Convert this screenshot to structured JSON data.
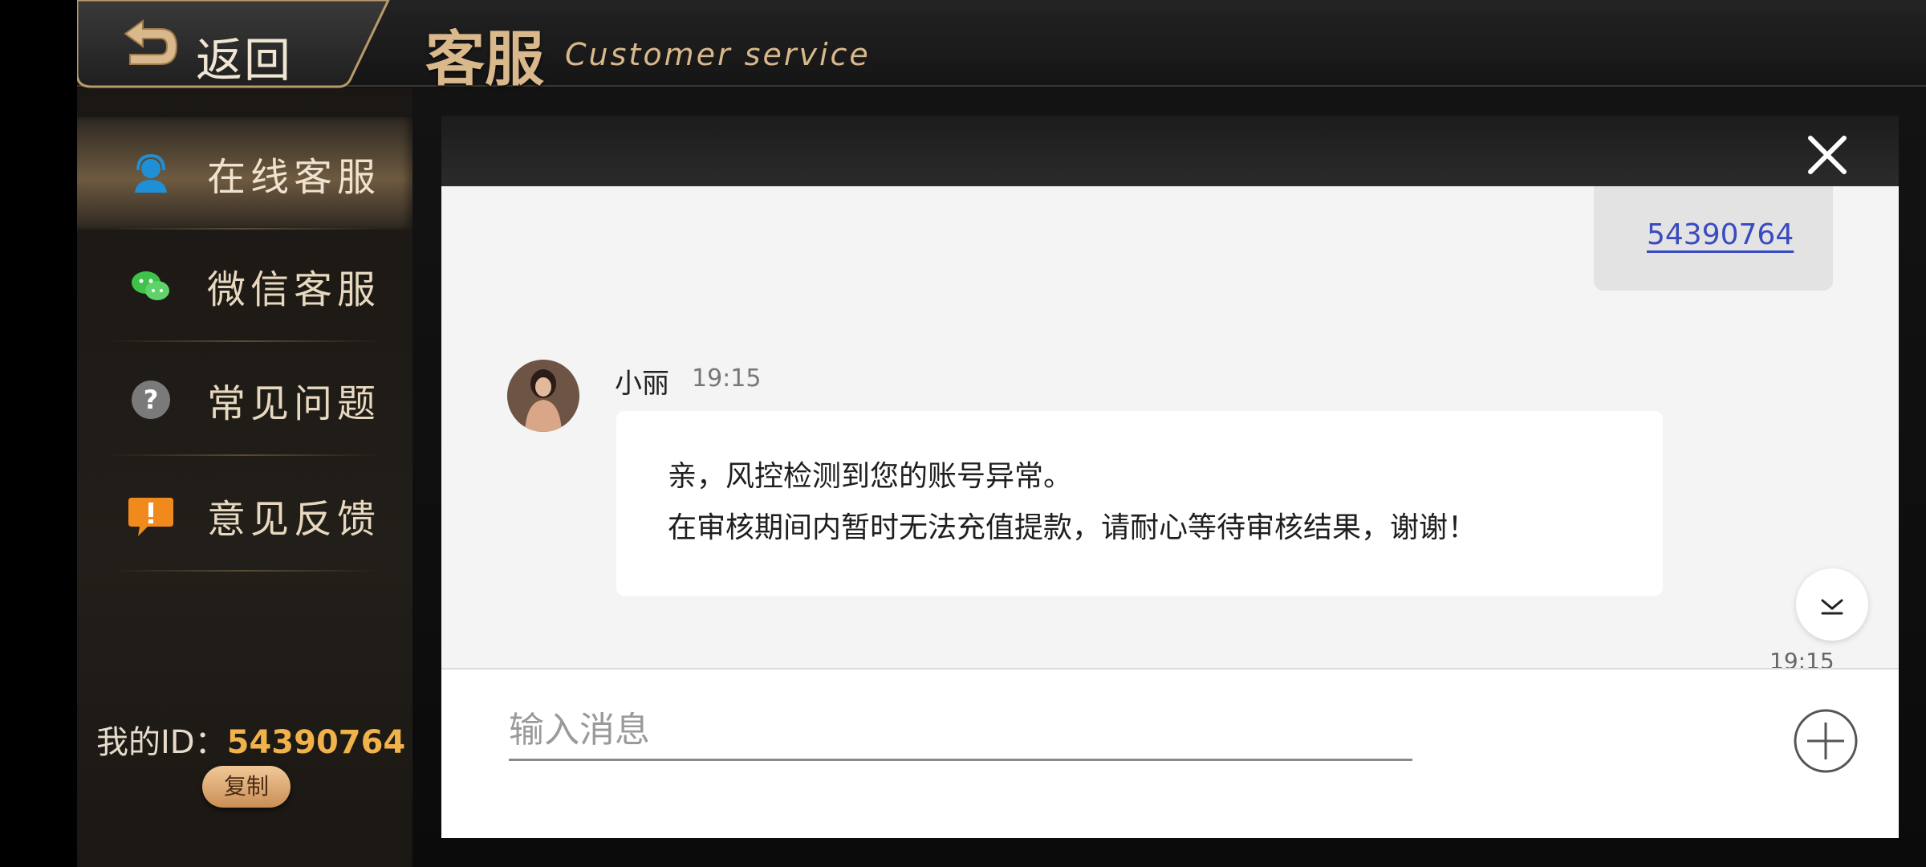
{
  "topbar": {
    "back_label": "返回",
    "title": "客服",
    "subtitle": "Customer service"
  },
  "sidebar": {
    "items": [
      {
        "label": "在线客服",
        "icon": "headset-agent-icon",
        "active": true
      },
      {
        "label": "微信客服",
        "icon": "wechat-icon",
        "active": false
      },
      {
        "label": "常见问题",
        "icon": "question-icon",
        "active": false
      },
      {
        "label": "意见反馈",
        "icon": "feedback-icon",
        "active": false
      }
    ],
    "my_id_label": "我的ID：",
    "my_id_value": "54390764",
    "copy_label": "复制"
  },
  "chat": {
    "my_message": "54390764",
    "agent_name": "小丽",
    "agent_time": "19:15",
    "agent_lines": [
      "亲，风控检测到您的账号异常。",
      "在审核期间内暂时无法充值提款，请耐心等待审核结果，谢谢！"
    ],
    "bottom_time": "19:15",
    "input_placeholder": "输入消息"
  },
  "colors": {
    "accent_gold": "#d9b88b",
    "id_orange": "#f0b24a",
    "link_blue": "#3a4ac0"
  }
}
